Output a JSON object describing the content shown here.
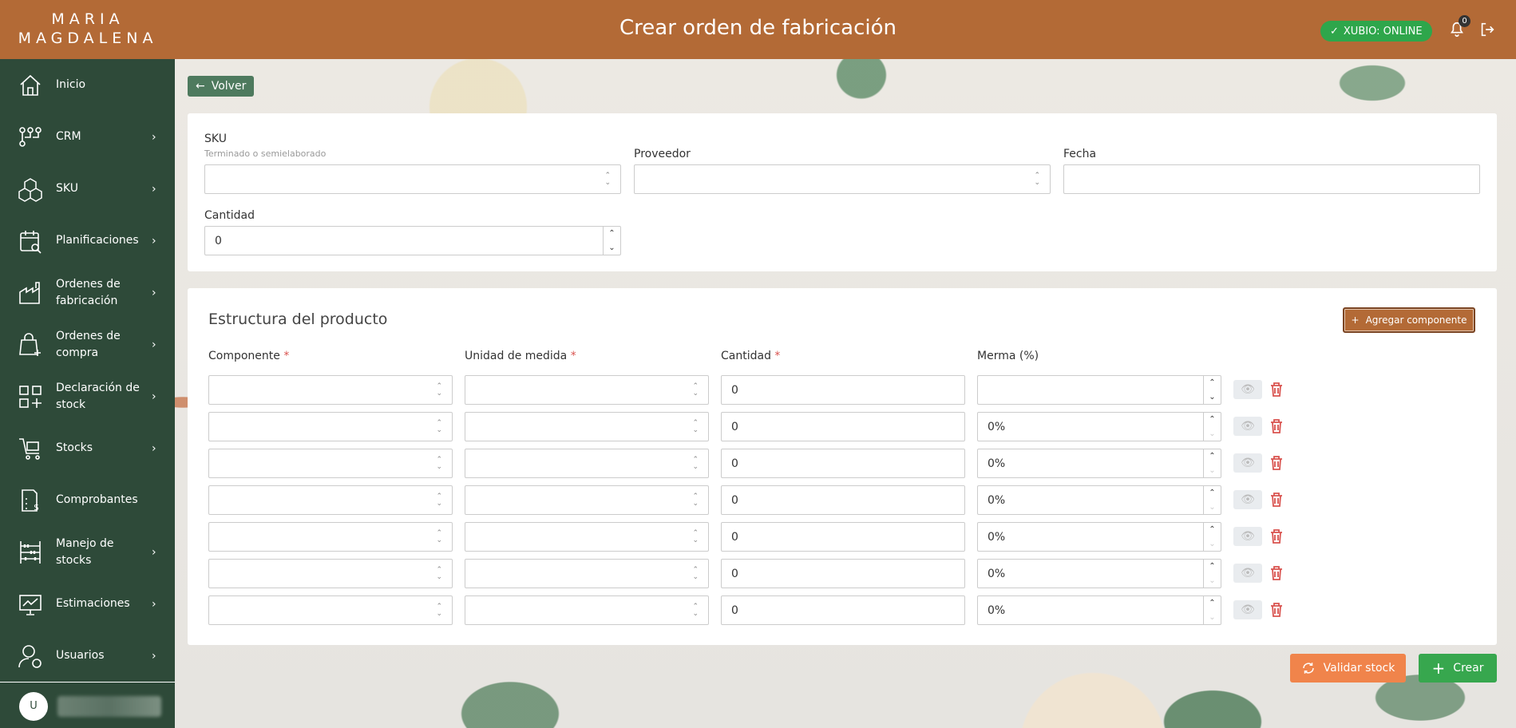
{
  "brand": {
    "line1": "MARIA",
    "line2": "MAGDALENA"
  },
  "header": {
    "title": "Crear orden de fabricación",
    "status": "XUBIO: ONLINE",
    "notifications_count": "0"
  },
  "sidebar": {
    "items": [
      {
        "label": "Inicio",
        "icon": "home-icon",
        "has_chevron": false
      },
      {
        "label": "CRM",
        "icon": "crm-icon",
        "has_chevron": true
      },
      {
        "label": "SKU",
        "icon": "boxes-icon",
        "has_chevron": true
      },
      {
        "label": "Planificaciones",
        "icon": "calendar-search-icon",
        "has_chevron": true
      },
      {
        "label": "Ordenes de fabricación",
        "icon": "factory-icon",
        "has_chevron": true
      },
      {
        "label": "Ordenes de compra",
        "icon": "shopping-bag-icon",
        "has_chevron": true
      },
      {
        "label": "Declaración de stock",
        "icon": "grid-plus-icon",
        "has_chevron": true
      },
      {
        "label": "Stocks",
        "icon": "cart-icon",
        "has_chevron": true
      },
      {
        "label": "Comprobantes",
        "icon": "receipt-icon",
        "has_chevron": false
      },
      {
        "label": "Manejo de stocks",
        "icon": "abacus-icon",
        "has_chevron": true
      },
      {
        "label": "Estimaciones",
        "icon": "presentation-icon",
        "has_chevron": true
      },
      {
        "label": "Usuarios",
        "icon": "user-icon",
        "has_chevron": true
      }
    ],
    "user_initial": "U"
  },
  "back_label": "Volver",
  "form": {
    "sku_label": "SKU",
    "sku_hint": "Terminado o semielaborado",
    "proveedor_label": "Proveedor",
    "fecha_label": "Fecha",
    "cantidad_label": "Cantidad",
    "cantidad_value": "0"
  },
  "estructura": {
    "title": "Estructura del producto",
    "add_label": "Agregar componente",
    "headers": {
      "componente": "Componente",
      "unidad": "Unidad de medida",
      "cantidad": "Cantidad",
      "merma": "Merma (%)",
      "required_mark": "*"
    },
    "rows": [
      {
        "cantidad": "0",
        "merma": ""
      },
      {
        "cantidad": "0",
        "merma": "0%"
      },
      {
        "cantidad": "0",
        "merma": "0%"
      },
      {
        "cantidad": "0",
        "merma": "0%"
      },
      {
        "cantidad": "0",
        "merma": "0%"
      },
      {
        "cantidad": "0",
        "merma": "0%"
      },
      {
        "cantidad": "0",
        "merma": "0%"
      }
    ]
  },
  "actions": {
    "validar": "Validar stock",
    "crear": "Crear"
  },
  "colors": {
    "brand": "#b36a36",
    "sidebar": "#2e4a39",
    "online": "#2ea64b",
    "validar": "#f0844b",
    "crear": "#37a74e",
    "danger": "#d9534f"
  }
}
